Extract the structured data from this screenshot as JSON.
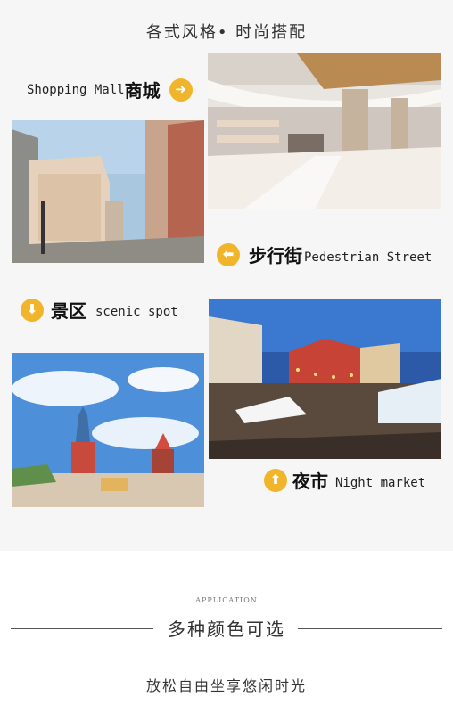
{
  "header": {
    "title": "各式风格• 时尚搭配"
  },
  "sections": {
    "mall": {
      "en": "Shopping Mall",
      "zh": "商城",
      "arrow": "right-arrow-icon"
    },
    "street": {
      "zh": "步行街",
      "en": "Pedestrian Street",
      "arrow": "left-arrow-icon"
    },
    "scenic": {
      "zh": "景区",
      "en": "scenic spot",
      "arrow": "down-arrow-icon"
    },
    "night": {
      "zh": "夜市",
      "en": "Night market",
      "arrow": "up-arrow-icon"
    }
  },
  "footer": {
    "tag": "APPLICATION",
    "subtitle": "多种颜色可选",
    "tagline": "放松自由坐享悠闲时光"
  },
  "colors": {
    "accent": "#f0b52a",
    "panel": "#f6f6f6"
  }
}
